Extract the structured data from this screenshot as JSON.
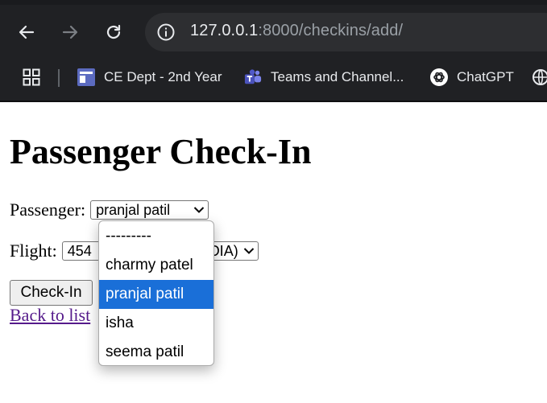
{
  "browser": {
    "url_host": "127.0.0.1",
    "url_rest": ":8000/checkins/add/",
    "bookmarks": [
      {
        "label": "CE Dept - 2nd Year"
      },
      {
        "label": "Teams and Channel..."
      },
      {
        "label": "ChatGPT"
      }
    ]
  },
  "page": {
    "title": "Passenger Check-In",
    "passenger_label": "Passenger:",
    "passenger_selected": "pranjal patil",
    "flight_label": "Flight:",
    "flight_selected_visible_start": "454",
    "flight_selected_visible_end": "DIA)",
    "submit_label": "Check-In",
    "back_link": "Back to list"
  },
  "dropdown": {
    "options": [
      "---------",
      "charmy patel",
      "pranjal patil",
      "isha",
      "seema patil"
    ],
    "selected_index": 2
  },
  "colors": {
    "chrome_bg": "#202124",
    "omnibox_bg": "#2d2e31",
    "selected_option": "#1a6fd8",
    "visited_link": "#551a8b"
  }
}
